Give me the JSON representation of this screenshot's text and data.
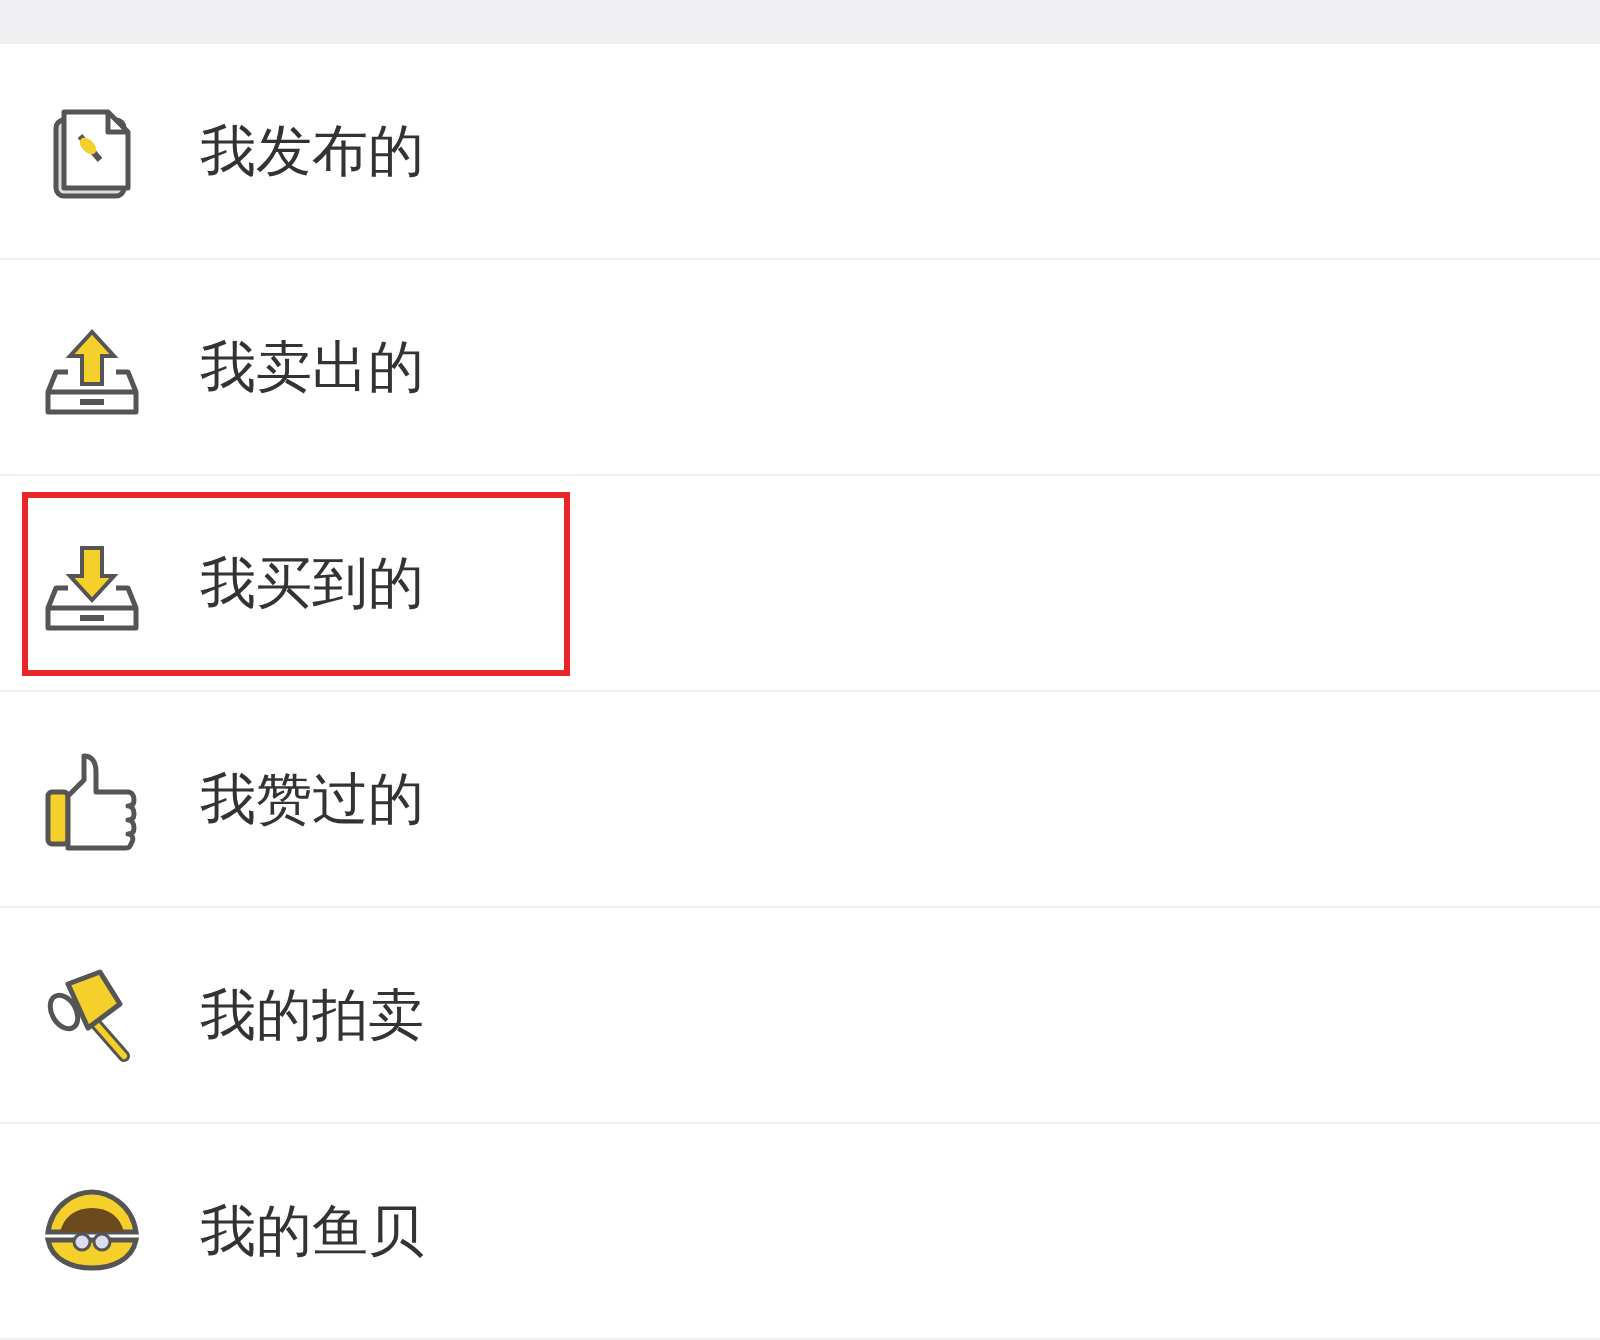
{
  "items": [
    {
      "kind": "document",
      "label": "我发布的",
      "highlighted": false
    },
    {
      "kind": "upload",
      "label": "我卖出的",
      "highlighted": false
    },
    {
      "kind": "download",
      "label": "我买到的",
      "highlighted": true
    },
    {
      "kind": "thumbs-up",
      "label": "我赞过的",
      "highlighted": false
    },
    {
      "kind": "hammer",
      "label": "我的拍卖",
      "highlighted": false
    },
    {
      "kind": "shell",
      "label": "我的鱼贝",
      "highlighted": false
    }
  ]
}
